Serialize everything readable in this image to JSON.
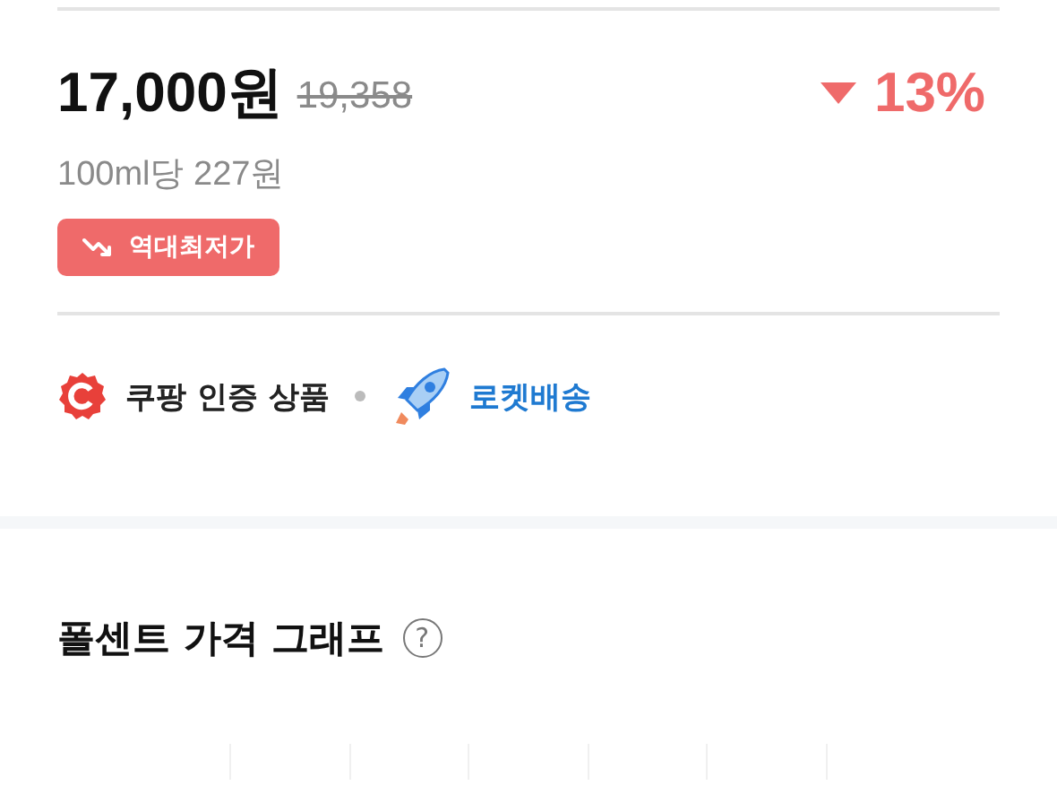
{
  "price": {
    "current": "17,000원",
    "original": "19,358",
    "discount": "13%",
    "unit_price": "100ml당 227원",
    "badge": "역대최저가"
  },
  "features": [
    {
      "kind": "certified",
      "label": "쿠팡 인증 상품"
    },
    {
      "kind": "rocket",
      "label": "로켓배송"
    }
  ],
  "graph": {
    "title": "폴센트 가격 그래프",
    "help": "?"
  }
}
